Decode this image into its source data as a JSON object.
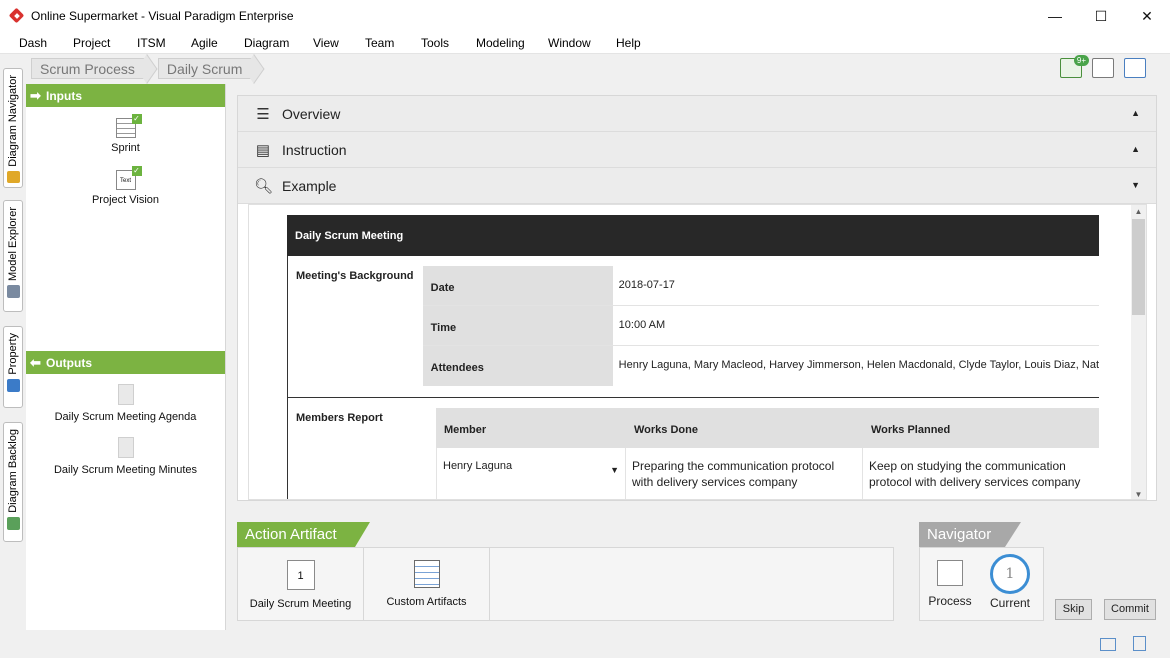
{
  "window": {
    "title": "Online Supermarket - Visual Paradigm Enterprise",
    "buttons": [
      "—",
      "☐",
      "✕"
    ]
  },
  "menu": [
    "Dash",
    "Project",
    "ITSM",
    "Agile",
    "Diagram",
    "View",
    "Team",
    "Tools",
    "Modeling",
    "Window",
    "Help"
  ],
  "side_tabs": [
    "Diagram Navigator",
    "Model Explorer",
    "Property",
    "Diagram Backlog"
  ],
  "breadcrumb": [
    "Scrum Process",
    "Daily Scrum"
  ],
  "toolbar": {
    "notification_badge": "9+"
  },
  "inputs": {
    "title": "Inputs",
    "items": [
      {
        "label": "Sprint",
        "icon_text": ""
      },
      {
        "label": "Project Vision",
        "icon_text": "Text"
      }
    ]
  },
  "outputs": {
    "title": "Outputs",
    "items": [
      {
        "label": "Daily Scrum Meeting Agenda"
      },
      {
        "label": "Daily Scrum Meeting Minutes"
      }
    ]
  },
  "accordion": [
    {
      "label": "Overview",
      "icon": "list-icon",
      "caret": "▲"
    },
    {
      "label": "Instruction",
      "icon": "instruction-icon",
      "caret": "▲"
    },
    {
      "label": "Example",
      "icon": "magnifier-icon",
      "caret": "▼"
    }
  ],
  "example": {
    "header": "Daily Scrum Meeting",
    "background_label": "Meeting's Background",
    "background": [
      {
        "key": "Date",
        "value": "2018-07-17"
      },
      {
        "key": "Time",
        "value": "10:00 AM"
      },
      {
        "key": "Attendees",
        "value": "Henry Laguna, Mary Macleod, Harvey Jimmerson, Helen Macdonald, Clyde Taylor, Louis Diaz, Nat"
      }
    ],
    "members_label": "Members Report",
    "members_columns": [
      "Member",
      "Works Done",
      "Works Planned"
    ],
    "members_rows": [
      {
        "member": "Henry Laguna",
        "done": "Preparing the communication protocol with delivery services company",
        "planned": "Keep on studying the communication protocol with delivery services company"
      }
    ]
  },
  "action_artifact": {
    "title": "Action Artifact",
    "items": [
      {
        "label": "Daily Scrum Meeting",
        "icon_text": "1"
      },
      {
        "label": "Custom Artifacts",
        "icon_text": ""
      }
    ]
  },
  "navigator": {
    "title": "Navigator",
    "process_label": "Process",
    "current_label": "Current",
    "current_number": "1"
  },
  "buttons": {
    "skip": "Skip",
    "commit": "Commit"
  }
}
